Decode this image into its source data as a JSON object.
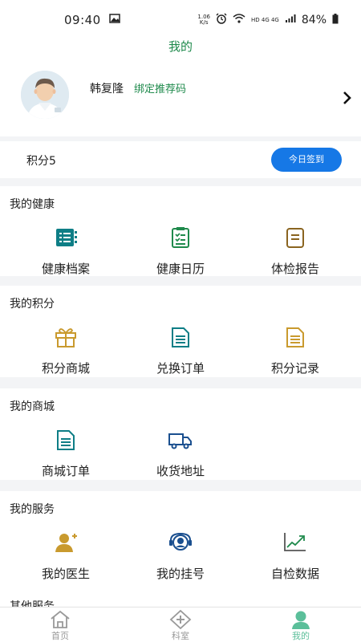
{
  "status_bar": {
    "time": "09:40",
    "speed_value": "1.06",
    "speed_unit": "K/s",
    "network": "HD 4G 4G",
    "battery": "84%"
  },
  "header": {
    "title": "我的"
  },
  "profile": {
    "name": "韩复隆",
    "bind_link": "绑定推荐码"
  },
  "points": {
    "text": "积分5",
    "checkin_label": "今日签到"
  },
  "sections": {
    "health": {
      "title": "我的健康",
      "items": [
        {
          "label": "健康档案",
          "icon": "health-record-icon"
        },
        {
          "label": "健康日历",
          "icon": "health-calendar-icon"
        },
        {
          "label": "体检报告",
          "icon": "checkup-report-icon"
        }
      ]
    },
    "points": {
      "title": "我的积分",
      "items": [
        {
          "label": "积分商城",
          "icon": "gift-icon"
        },
        {
          "label": "兑换订单",
          "icon": "exchange-order-icon"
        },
        {
          "label": "积分记录",
          "icon": "points-record-icon"
        }
      ]
    },
    "mall": {
      "title": "我的商城",
      "items": [
        {
          "label": "商城订单",
          "icon": "mall-order-icon"
        },
        {
          "label": "收货地址",
          "icon": "delivery-truck-icon"
        }
      ]
    },
    "service": {
      "title": "我的服务",
      "items": [
        {
          "label": "我的医生",
          "icon": "doctor-icon"
        },
        {
          "label": "我的挂号",
          "icon": "registration-icon"
        },
        {
          "label": "自检数据",
          "icon": "self-check-chart-icon"
        }
      ]
    },
    "other": {
      "title": "其他服务"
    }
  },
  "tabs": [
    {
      "label": "首页",
      "icon": "home-icon",
      "active": false
    },
    {
      "label": "科室",
      "icon": "department-icon",
      "active": false
    },
    {
      "label": "我的",
      "icon": "profile-icon",
      "active": true
    }
  ],
  "colors": {
    "brand_green": "#1f8a4c",
    "teal": "#0e7e86",
    "gold": "#c99a2e",
    "blue_button": "#1678e6",
    "tab_active": "#5bbf9a"
  }
}
